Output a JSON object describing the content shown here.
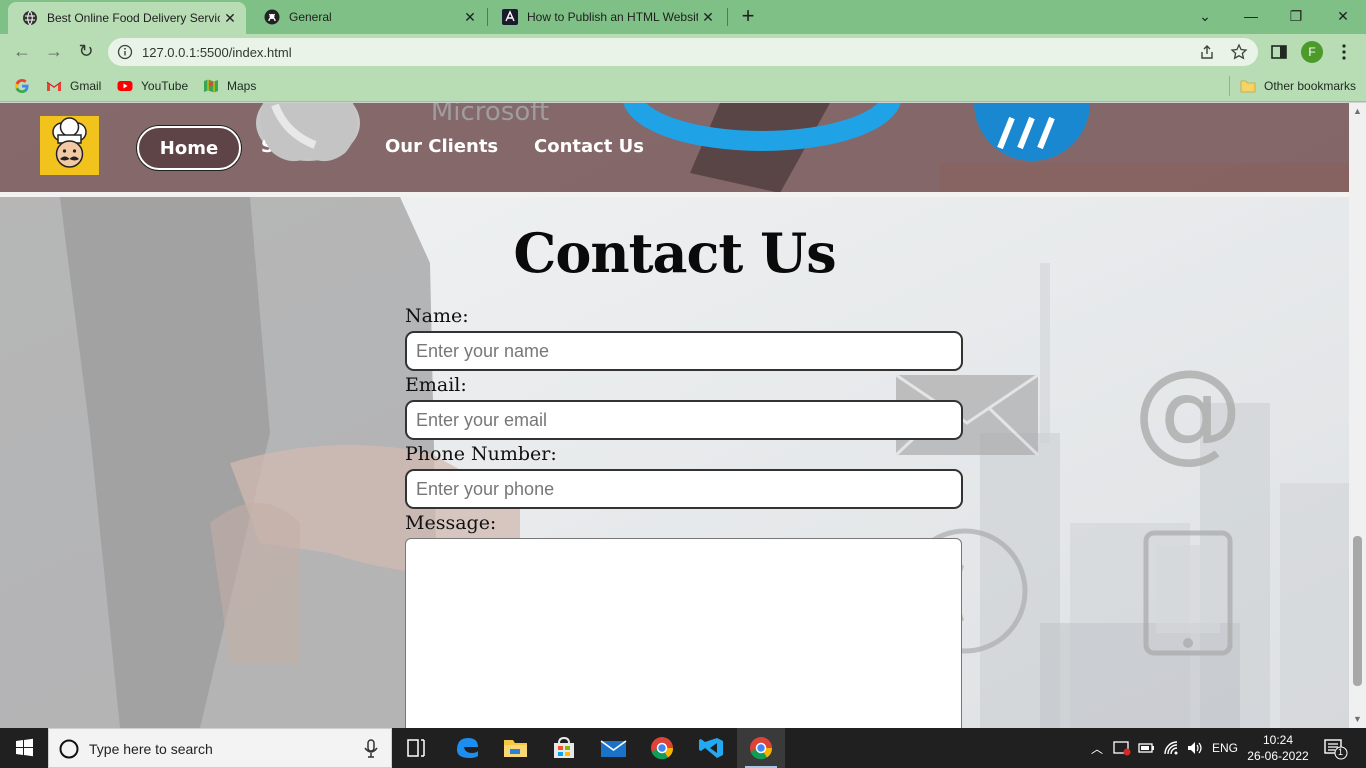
{
  "browser": {
    "tabs": [
      {
        "title": "Best Online Food Delivery Service",
        "icon": "globe-icon",
        "active": true
      },
      {
        "title": "General",
        "icon": "github-icon",
        "active": false
      },
      {
        "title": "How to Publish an HTML Website",
        "icon": "site-icon",
        "active": false
      }
    ],
    "url": "127.0.0.1:5500/index.html",
    "profile_initial": "F",
    "bookmarks": [
      {
        "label": "Gmail",
        "icon": "gmail-icon"
      },
      {
        "label": "YouTube",
        "icon": "youtube-icon"
      },
      {
        "label": "Maps",
        "icon": "maps-icon"
      }
    ],
    "other_bookmarks": "Other bookmarks",
    "colors": {
      "tabbar": "#7ec085",
      "toolbar": "#b8dcb4"
    }
  },
  "page": {
    "nav": {
      "items": [
        "Home",
        "Se",
        "Our Clients",
        "Contact Us"
      ],
      "active": "Home",
      "background_logos": [
        "Microsoft"
      ]
    },
    "contact": {
      "title": "Contact Us",
      "fields": [
        {
          "label": "Name:",
          "placeholder": "Enter your name"
        },
        {
          "label": "Email:",
          "placeholder": "Enter your email"
        },
        {
          "label": "Phone Number:",
          "placeholder": "Enter your phone"
        }
      ],
      "message_label": "Message:",
      "message_value": ""
    },
    "colors": {
      "nav_bg": "#785658",
      "logo_bg": "#f2c21d",
      "title": "#0a0a0a"
    }
  },
  "taskbar": {
    "search_placeholder": "Type here to search",
    "language": "ENG",
    "time": "10:24",
    "date": "26-06-2022",
    "notification_count": "1"
  }
}
